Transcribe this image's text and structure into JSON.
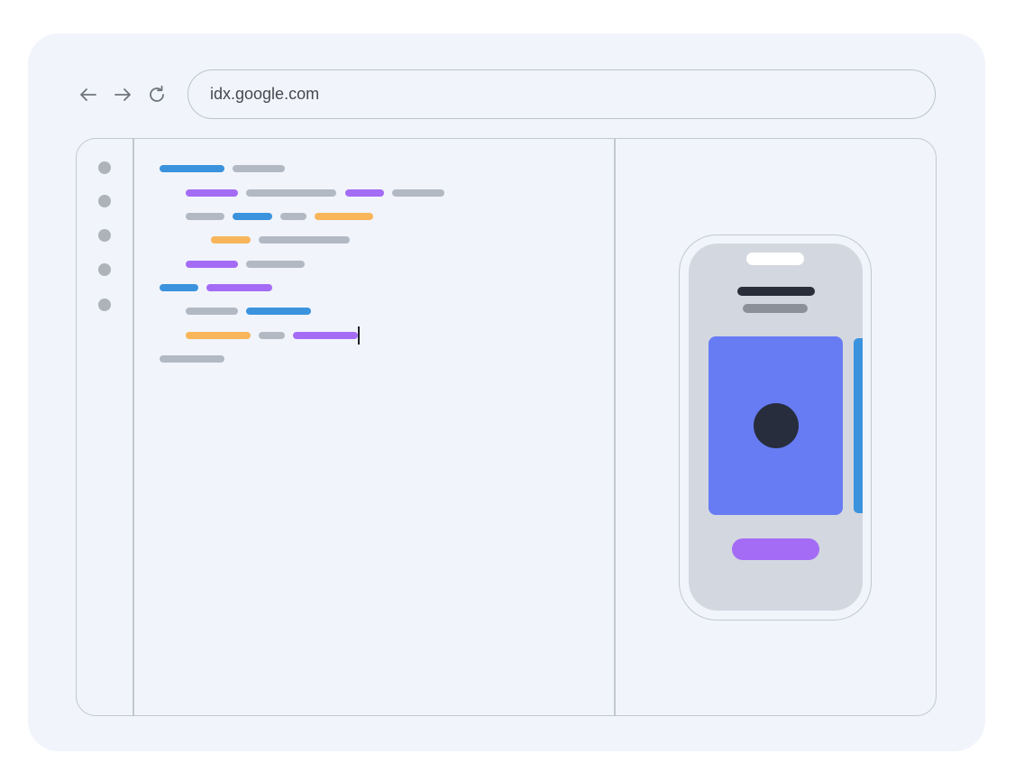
{
  "browser": {
    "url": "idx.google.com",
    "icons": [
      "back-arrow-icon",
      "forward-arrow-icon",
      "refresh-icon"
    ]
  },
  "colors": {
    "background": "#f1f4fb",
    "code_blue": "#3b93de",
    "code_purple": "#a46cf5",
    "code_orange": "#f8b55a",
    "code_gray": "#b3b9c2",
    "card": "#677cf3",
    "card_dot": "#272d3d"
  },
  "code_lines": [
    [
      "blue",
      "gray"
    ],
    [
      "purple",
      "gray",
      "purple",
      "gray"
    ],
    [
      "gray",
      "blue",
      "gray",
      "orange"
    ],
    [
      "orange",
      "gray"
    ],
    [
      "purple",
      "gray"
    ],
    [
      "blue",
      "purple"
    ],
    [
      "gray",
      "blue"
    ],
    [
      "orange",
      "gray",
      "purple"
    ],
    [
      "gray"
    ]
  ]
}
